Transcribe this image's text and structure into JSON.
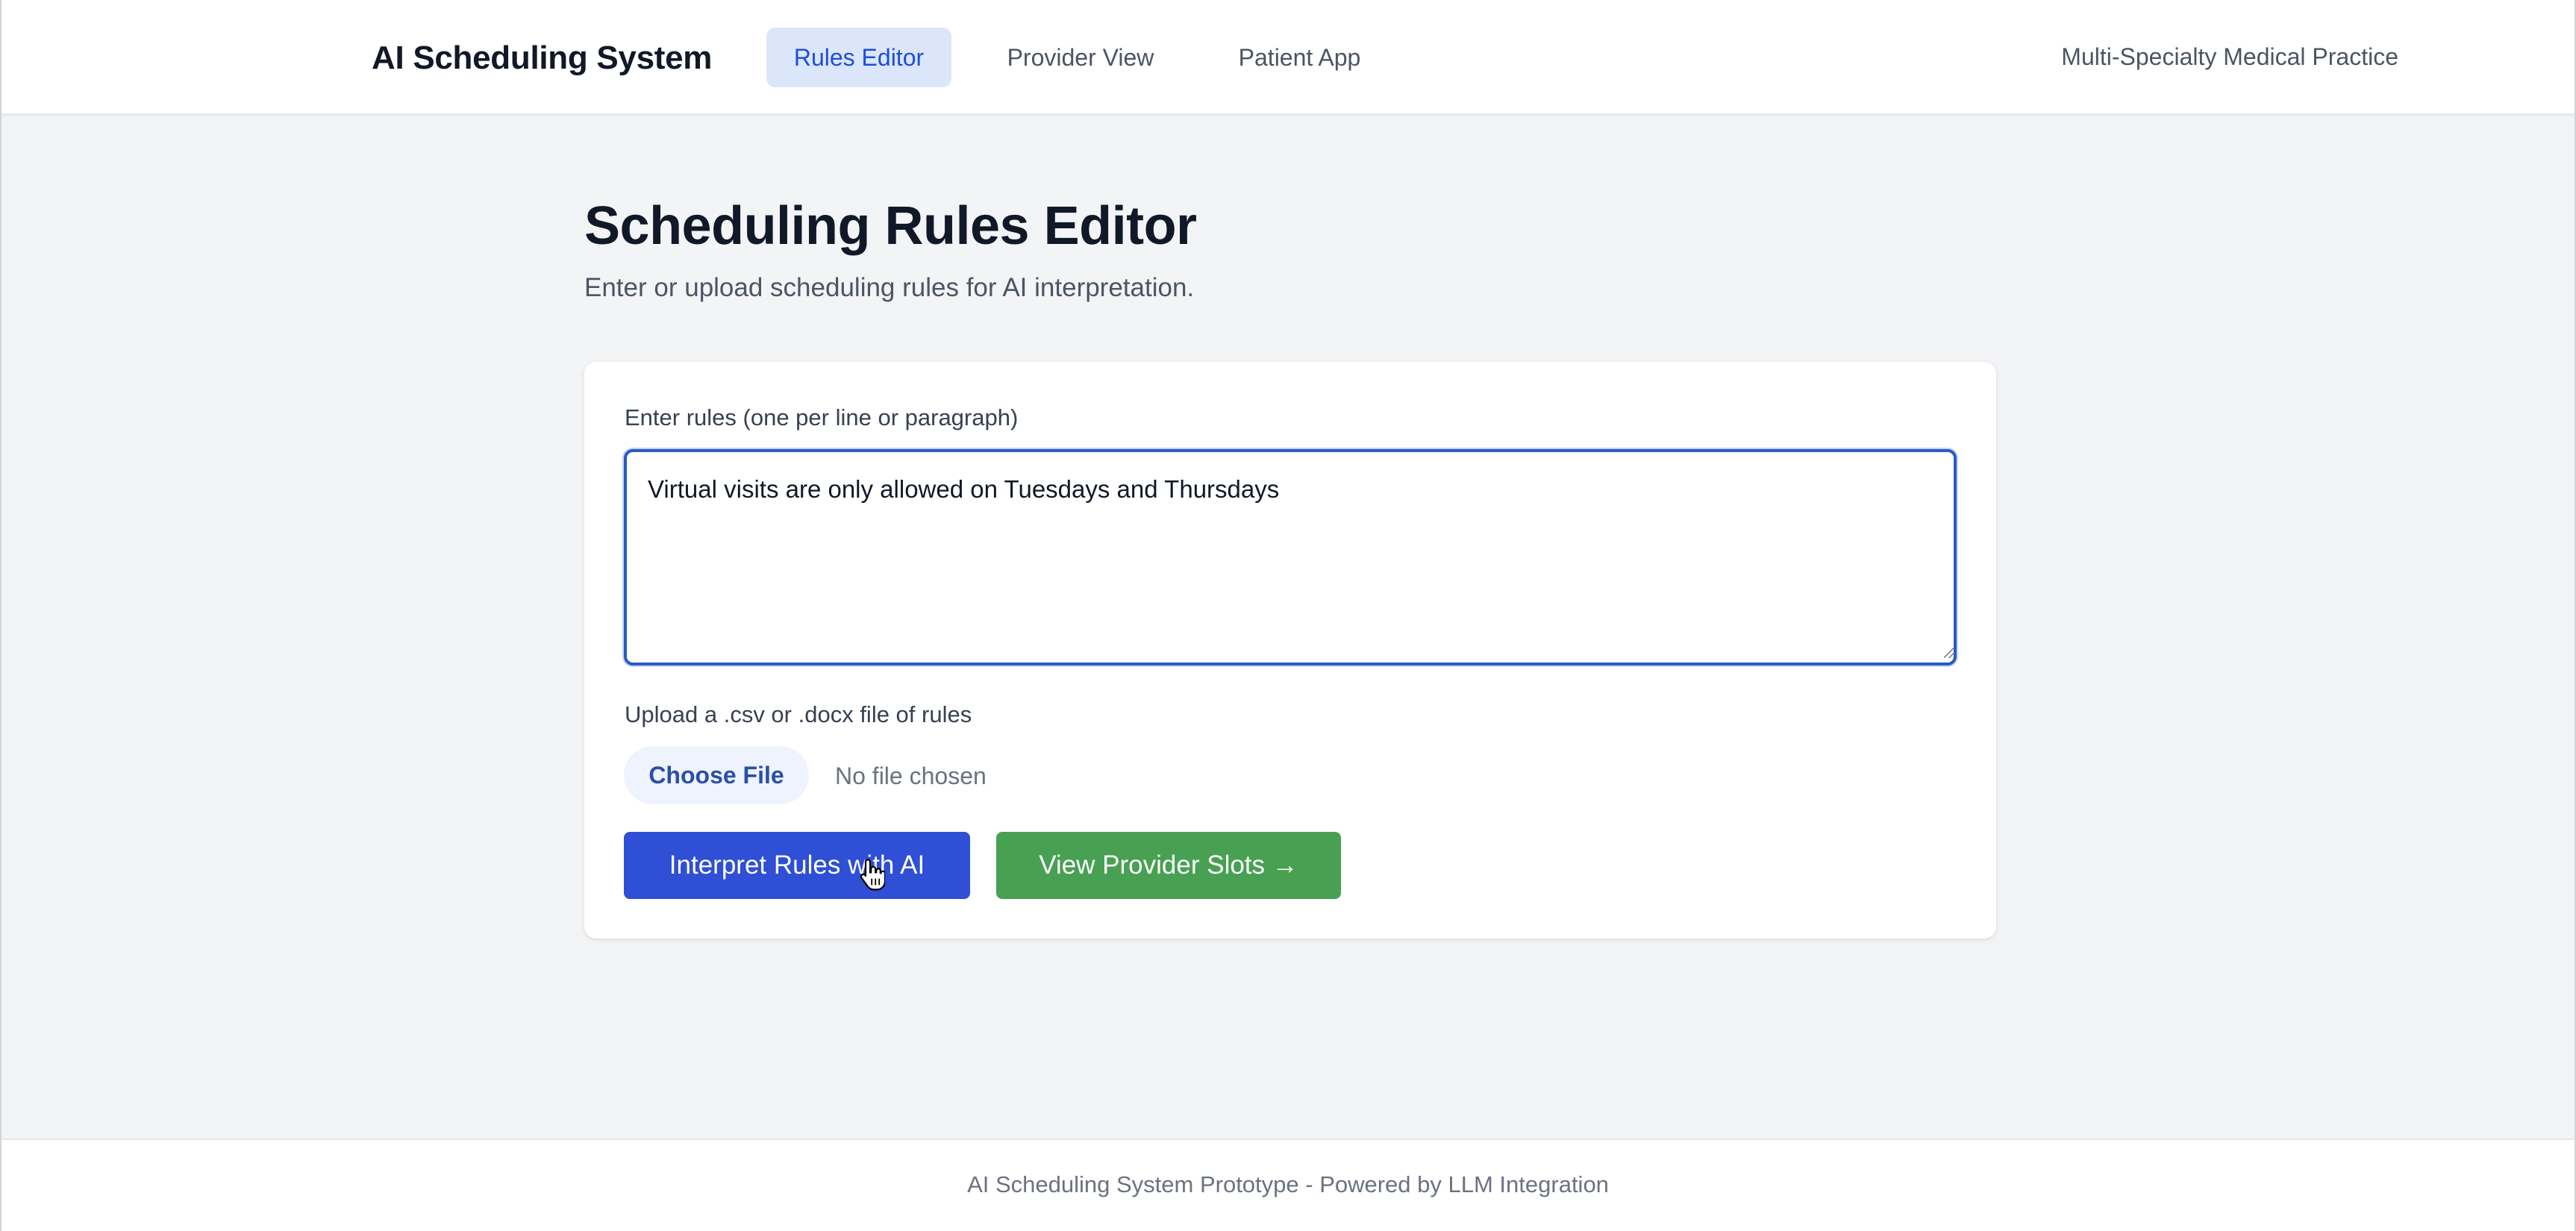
{
  "header": {
    "brand": "AI Scheduling System",
    "tabs": [
      {
        "label": "Rules Editor",
        "active": true
      },
      {
        "label": "Provider View",
        "active": false
      },
      {
        "label": "Patient App",
        "active": false
      }
    ],
    "practice_name": "Multi-Specialty Medical Practice"
  },
  "main": {
    "title": "Scheduling Rules Editor",
    "subtitle": "Enter or upload scheduling rules for AI interpretation.",
    "rules": {
      "label": "Enter rules (one per line or paragraph)",
      "value": "Virtual visits are only allowed on Tuesdays and Thursdays"
    },
    "upload": {
      "label": "Upload a .csv or .docx file of rules",
      "button_label": "Choose File",
      "status": "No file chosen"
    },
    "actions": {
      "interpret_label": "Interpret Rules with AI",
      "view_slots_label": "View Provider Slots →"
    }
  },
  "footer": {
    "text": "AI Scheduling System Prototype - Powered by LLM Integration"
  },
  "colors": {
    "accent": "#2e4fd6",
    "success": "#48a052",
    "active_tab_bg": "#dbe6fb",
    "active_tab_text": "#1d4ed8",
    "page_bg": "#f3f4f6"
  },
  "icons": {
    "cursor": "hand-pointer-icon",
    "resize": "resize-grip-icon"
  }
}
